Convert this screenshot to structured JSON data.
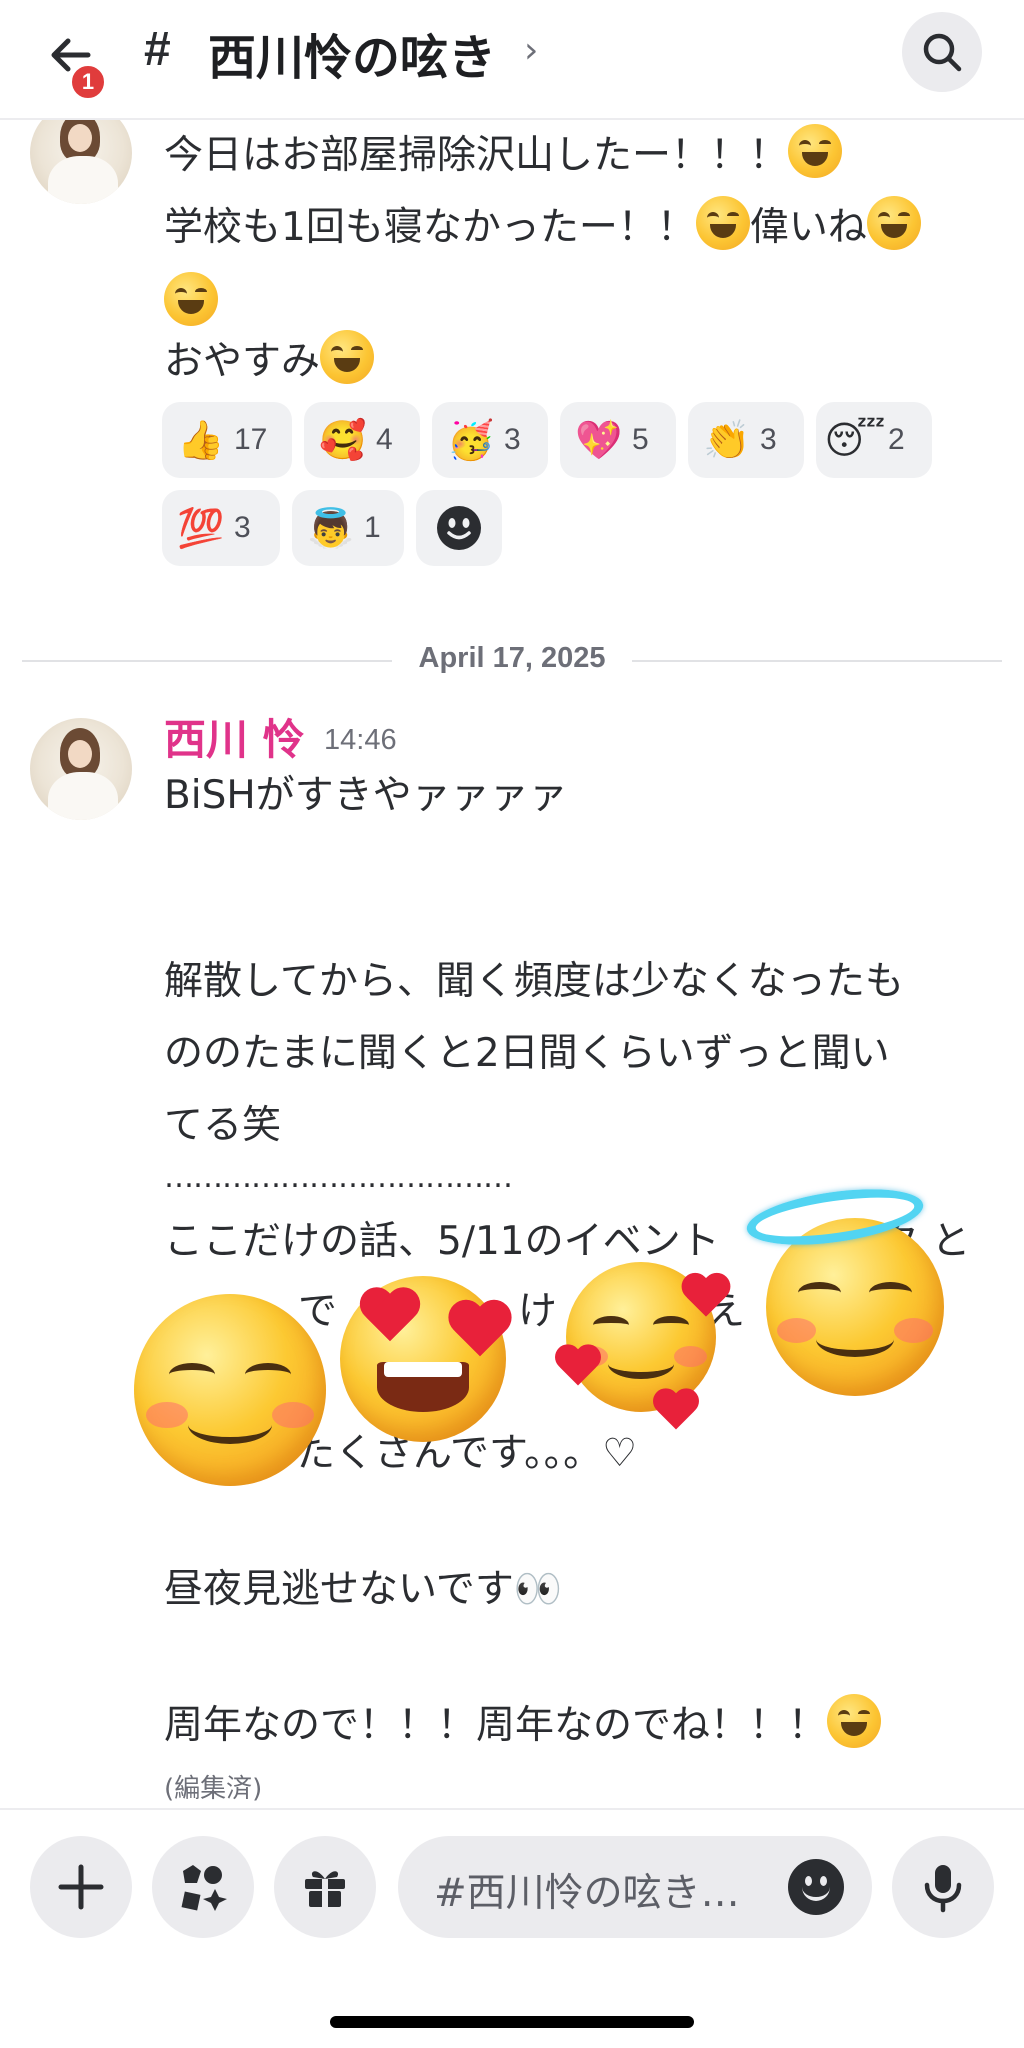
{
  "header": {
    "back_badge": "1",
    "hash": "#",
    "channel_title": "西川怜の呟き",
    "chevron": "›",
    "icons": {
      "back": "arrow-left-icon",
      "search": "search-icon"
    }
  },
  "previous_message": {
    "lines": [
      {
        "text": "今日はお部屋掃除沢山したー！！！",
        "emoji": "laughing-emoji"
      },
      {
        "text": "学校も1回も寝なかったー！！",
        "emoji_mid": "laughing-emoji",
        "text2": "偉いね",
        "emoji": "laughing-emoji"
      },
      {
        "text": "",
        "emoji": "laughing-emoji"
      },
      {
        "text": "おやすみ",
        "emoji": "laughing-emoji"
      }
    ],
    "reactions": [
      {
        "emoji": "👍",
        "name": "thumbs-up",
        "count": "17"
      },
      {
        "emoji": "🥰",
        "name": "smiling-face-with-hearts",
        "count": "4"
      },
      {
        "emoji": "🥳",
        "name": "partying-face",
        "count": "3"
      },
      {
        "emoji": "💖",
        "name": "sparkling-heart",
        "count": "5"
      },
      {
        "emoji": "👏",
        "name": "clapping-hands",
        "count": "3"
      },
      {
        "emoji": "😴",
        "name": "sleeping-face",
        "count": "2"
      },
      {
        "emoji": "💯",
        "name": "hundred-points",
        "count": "3"
      },
      {
        "emoji": "👼",
        "name": "baby-angel",
        "count": "1"
      }
    ]
  },
  "date_divider": "April 17, 2025",
  "message": {
    "author": "西川 怜",
    "author_color": "#e0338a",
    "time": "14:46",
    "lines": [
      "BiSHがすきやァァァァ",
      "",
      "",
      "解散してから、聞く頻度は少なくなったも",
      "ののたまに聞くと2日間くらいずっと聞い",
      "てる笑",
      "………………………………",
      "ここだけの話、5/11のイベント",
      "",
      "たくさんです。。。♡",
      "",
      "昼夜見逃せないです👀",
      "",
      "周年なので！！！周年なのでね！！！"
    ],
    "fragments": {
      "line8_end": "ク と",
      "line9_a": "で",
      "line9_b": "け",
      "line9_c": "え"
    },
    "edited": "(編集済)"
  },
  "bottom_bar": {
    "placeholder": "#西川怜の呟き…",
    "icons": [
      "plus-icon",
      "apps-icon",
      "gift-icon",
      "emoji-icon",
      "microphone-icon"
    ]
  },
  "floating_emojis": [
    "smiling-face-emoji",
    "heart-eyes-emoji",
    "smiling-face-with-hearts-emoji",
    "halo-face-emoji"
  ],
  "colors": {
    "accent_pink": "#e0338a",
    "badge_red": "#e03c3c",
    "background": "#ffffff",
    "chip_bg": "#f0f1f3"
  }
}
